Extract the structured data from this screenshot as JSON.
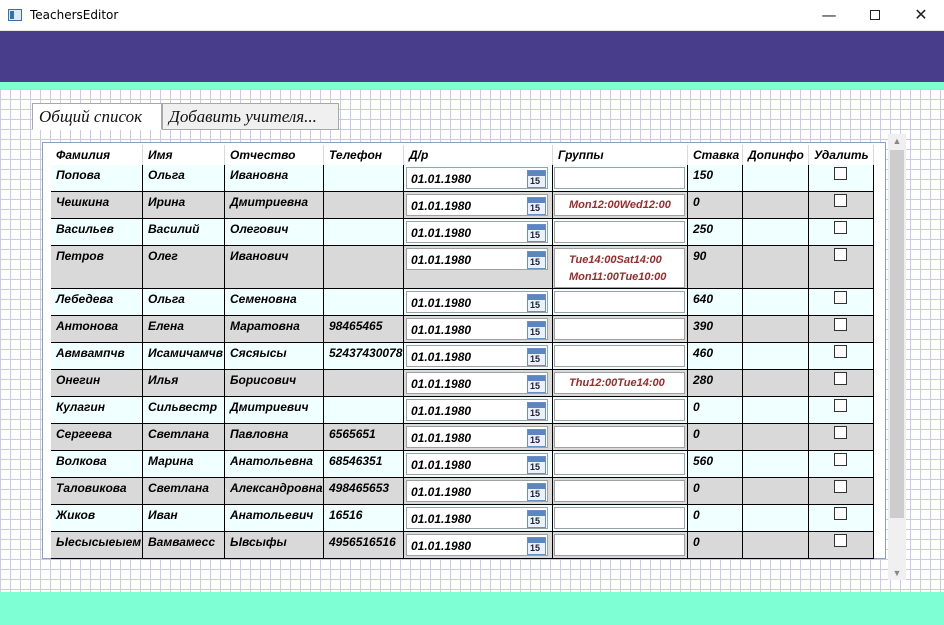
{
  "window": {
    "title": "TeachersEditor",
    "minimize": "—",
    "close": "✕"
  },
  "colors": {
    "top_band": "#483d8b",
    "mint": "#7fffd4",
    "row_odd": "#f0ffff",
    "row_even": "#d9d9d9",
    "group_text": "#9b2b2b"
  },
  "tabs": [
    {
      "label": "Общий список",
      "active": true
    },
    {
      "label": "Добавить учителя...",
      "active": false
    }
  ],
  "table": {
    "columns": [
      "Фамилия",
      "Имя",
      "Отчество",
      "Телефон",
      "Д/р",
      "Группы",
      "Ставка",
      "Допинфо",
      "Удалить"
    ],
    "rows": [
      {
        "last": "Попова",
        "first": "Ольга",
        "middle": "Ивановна",
        "phone": "",
        "birth": "01.01.1980",
        "groups": [],
        "rate": "150",
        "info": "",
        "delete": false
      },
      {
        "last": "Чешкина",
        "first": "Ирина",
        "middle": "Дмитриевна",
        "phone": "",
        "birth": "01.01.1980",
        "groups": [
          "Mon12:00Wed12:00"
        ],
        "rate": "0",
        "info": "",
        "delete": false
      },
      {
        "last": "Васильев",
        "first": "Василий",
        "middle": "Олегович",
        "phone": "",
        "birth": "01.01.1980",
        "groups": [],
        "rate": "250",
        "info": "",
        "delete": false
      },
      {
        "last": "Петров",
        "first": "Олег",
        "middle": "Иванович",
        "phone": "",
        "birth": "01.01.1980",
        "groups": [
          "Tue14:00Sat14:00",
          "Mon11:00Tue10:00"
        ],
        "rate": "90",
        "info": "",
        "delete": false
      },
      {
        "last": "Лебедева",
        "first": "Ольга",
        "middle": "Семеновна",
        "phone": "",
        "birth": "01.01.1980",
        "groups": [],
        "rate": "640",
        "info": "",
        "delete": false
      },
      {
        "last": "Антонова",
        "first": "Елена",
        "middle": "Маратовна",
        "phone": "98465465",
        "birth": "01.01.1980",
        "groups": [],
        "rate": "390",
        "info": "",
        "delete": false
      },
      {
        "last": "Авмвампчв",
        "first": "Исамичамчв",
        "middle": "Сясяысы",
        "phone": "52437430078",
        "birth": "01.01.1980",
        "groups": [],
        "rate": "460",
        "info": "",
        "delete": false
      },
      {
        "last": "Онегин",
        "first": "Илья",
        "middle": "Борисович",
        "phone": "",
        "birth": "01.01.1980",
        "groups": [
          "Thu12:00Tue14:00"
        ],
        "rate": "280",
        "info": "",
        "delete": false
      },
      {
        "last": "Кулагин",
        "first": "Сильвестр",
        "middle": "Дмитриевич",
        "phone": "",
        "birth": "01.01.1980",
        "groups": [],
        "rate": "0",
        "info": "",
        "delete": false
      },
      {
        "last": "Сергеева",
        "first": "Светлана",
        "middle": "Павловна",
        "phone": "6565651",
        "birth": "01.01.1980",
        "groups": [],
        "rate": "0",
        "info": "",
        "delete": false
      },
      {
        "last": "Волкова",
        "first": "Марина",
        "middle": "Анатольевна",
        "phone": "68546351",
        "birth": "01.01.1980",
        "groups": [],
        "rate": "560",
        "info": "",
        "delete": false
      },
      {
        "last": "Таловикова",
        "first": "Светлана",
        "middle": "Александровна",
        "phone": "498465653",
        "birth": "01.01.1980",
        "groups": [],
        "rate": "0",
        "info": "",
        "delete": false
      },
      {
        "last": "Жиков",
        "first": "Иван",
        "middle": "Анатольевич",
        "phone": "16516",
        "birth": "01.01.1980",
        "groups": [],
        "rate": "0",
        "info": "",
        "delete": false
      },
      {
        "last": "Ыесысыеыем",
        "first": "Вамвамесс",
        "middle": "Ывсыфы",
        "phone": "4956516516",
        "birth": "01.01.1980",
        "groups": [],
        "rate": "0",
        "info": "",
        "delete": false
      }
    ]
  },
  "icons": {
    "calendar": "calendar-icon",
    "calendar_day": "15",
    "scroll_up": "▲",
    "scroll_down": "▼"
  }
}
